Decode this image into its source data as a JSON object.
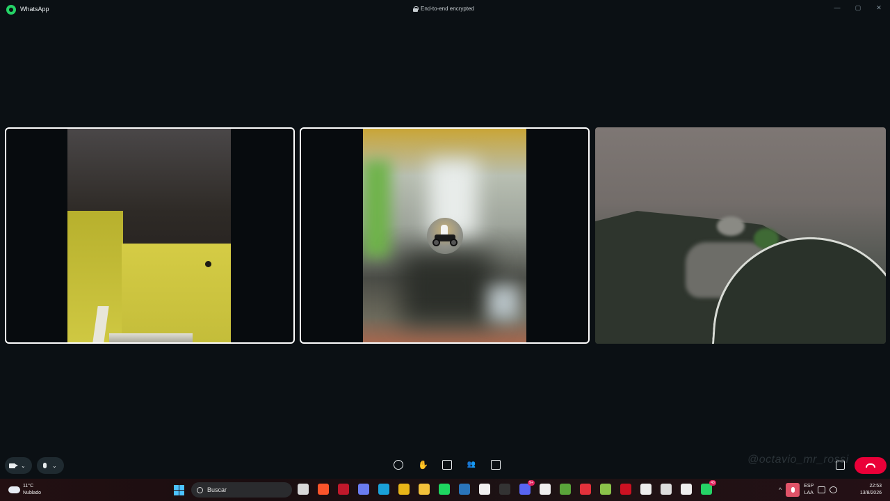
{
  "window": {
    "app_title": "WhatsApp",
    "encryption_label": "End-to-end encrypted",
    "minimize": "—",
    "maximize": "▢",
    "close": "✕"
  },
  "call": {
    "participants": [
      {
        "id": "participant-1",
        "active_speaker": true,
        "video": "on"
      },
      {
        "id": "participant-2",
        "active_speaker": true,
        "video": "off-avatar"
      },
      {
        "id": "participant-3",
        "active_speaker": false,
        "video": "on"
      }
    ],
    "controls": {
      "video_chevron": "⌄",
      "mic_chevron": "⌄",
      "middle_icons": [
        "emoji-icon",
        "raise-hand-icon",
        "share-screen-icon",
        "participants-icon",
        "captions-icon"
      ],
      "raise_hand_glyph": "✋",
      "participants_glyph": "👥"
    },
    "watermark": "@octavio_mr_rossi",
    "end_call_color": "#ea0038"
  },
  "taskbar": {
    "weather_temp": "11°C",
    "weather_desc": "Nublado",
    "search_placeholder": "Buscar",
    "pinned_apps": [
      {
        "name": "task-view",
        "color": "#d8d8d8"
      },
      {
        "name": "brave",
        "color": "#fb542b"
      },
      {
        "name": "red-app",
        "color": "#c0182b"
      },
      {
        "name": "copilot",
        "color": "#6a7cf0"
      },
      {
        "name": "edge",
        "color": "#1aa0d8"
      },
      {
        "name": "chrome",
        "color": "#e9b518"
      },
      {
        "name": "file-explorer",
        "color": "#f3c13a"
      },
      {
        "name": "spotify",
        "color": "#1ed760"
      },
      {
        "name": "steam",
        "color": "#2a75bb"
      },
      {
        "name": "store",
        "color": "#f0f0f0"
      },
      {
        "name": "epic-games",
        "color": "#333333"
      },
      {
        "name": "discord",
        "color": "#5865f2",
        "badge": "9+"
      },
      {
        "name": "capcut",
        "color": "#eeeeee"
      },
      {
        "name": "minecraft",
        "color": "#5aa43a"
      },
      {
        "name": "red-circle-app",
        "color": "#e3313b"
      },
      {
        "name": "green-app",
        "color": "#8bc34a"
      },
      {
        "name": "red-logo-app",
        "color": "#cc1122"
      },
      {
        "name": "wallpaper-app",
        "color": "#eeeeee"
      },
      {
        "name": "obs",
        "color": "#dddddd"
      },
      {
        "name": "capcut-2",
        "color": "#eeeeee"
      },
      {
        "name": "whatsapp",
        "color": "#25d366",
        "badge": "43"
      }
    ],
    "language_top": "ESP",
    "language_bottom": "LAA",
    "time": "22:53",
    "date": "13/8/2026",
    "tray_chevron": "^"
  }
}
